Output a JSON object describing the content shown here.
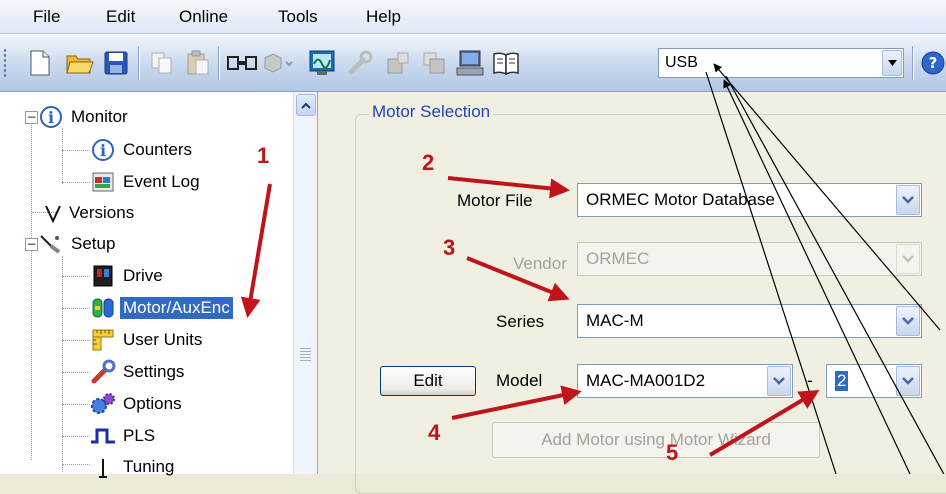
{
  "menu": {
    "items": [
      "File",
      "Edit",
      "Online",
      "Tools",
      "Help"
    ]
  },
  "toolbar": {
    "icons": [
      "new-file-icon",
      "open-folder-icon",
      "save-icon",
      "copy-icon",
      "paste-icon",
      "connect-icon",
      "disconnect-icon",
      "scope-icon",
      "wrench-icon",
      "upload-icon",
      "download-icon",
      "computer-icon",
      "manual-icon"
    ],
    "connection": {
      "value": "USB"
    },
    "help_icon": "help-icon"
  },
  "tree": {
    "items": [
      {
        "label": "Monitor",
        "icon": "info-icon"
      },
      {
        "label": "Counters",
        "icon": "info-icon"
      },
      {
        "label": "Event Log",
        "icon": "event-log-icon"
      },
      {
        "label": "Versions",
        "icon": "versions-icon"
      },
      {
        "label": "Setup",
        "icon": "setup-icon"
      },
      {
        "label": "Drive",
        "icon": "drive-icon"
      },
      {
        "label": "Motor/AuxEnc",
        "icon": "motor-icon",
        "selected": true
      },
      {
        "label": "User Units",
        "icon": "ruler-icon"
      },
      {
        "label": "Settings",
        "icon": "settings-icon"
      },
      {
        "label": "Options",
        "icon": "options-icon"
      },
      {
        "label": "PLS",
        "icon": "pulse-icon"
      },
      {
        "label": "Tuning",
        "icon": "tuning-icon"
      }
    ]
  },
  "motor_selection": {
    "title": "Motor Selection",
    "motor_file": {
      "label": "Motor File",
      "value": "ORMEC Motor Database"
    },
    "vendor": {
      "label": "Vendor",
      "value": "ORMEC"
    },
    "series": {
      "label": "Series",
      "value": "MAC-M"
    },
    "edit_button": "Edit",
    "model": {
      "label": "Model",
      "value": "MAC-MA001D2"
    },
    "separator": "-",
    "winding": {
      "value": "2"
    },
    "wizard_button": "Add Motor using Motor Wizard"
  },
  "annotations": {
    "steps": [
      "1",
      "2",
      "3",
      "4",
      "5"
    ],
    "arrow_color": "#c0141a"
  }
}
